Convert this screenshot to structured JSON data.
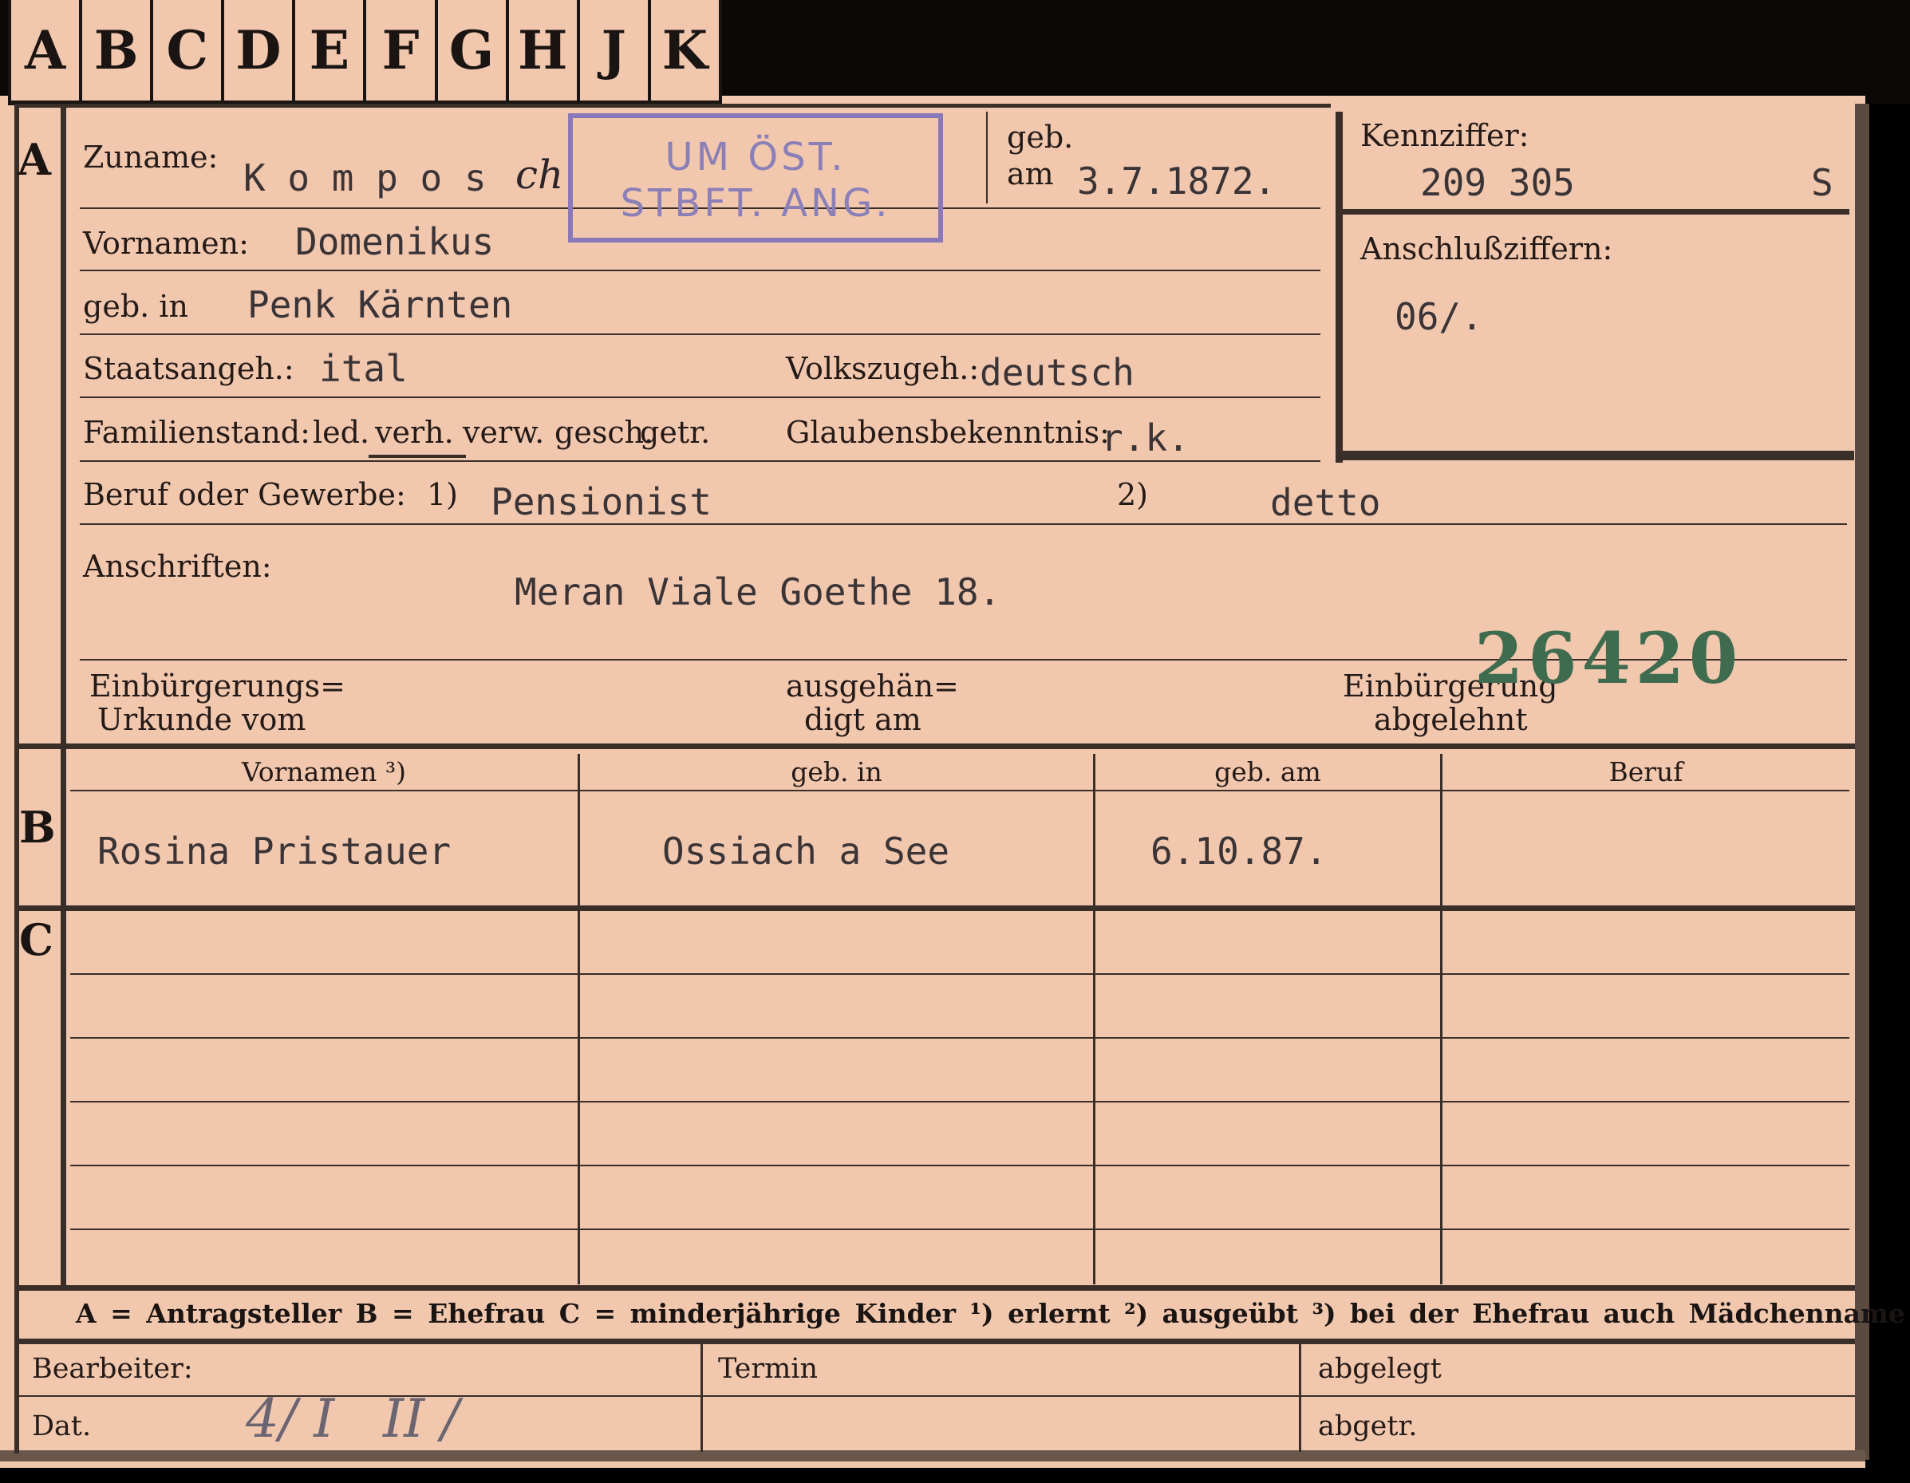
{
  "tabs": [
    "A",
    "B",
    "C",
    "D",
    "E",
    "F",
    "G",
    "H",
    "J",
    "K"
  ],
  "section_letters": {
    "a": "A",
    "b": "B",
    "c": "C"
  },
  "labels": {
    "zuname": "Zuname:",
    "geb": "geb.",
    "am": "am",
    "kennziffer": "Kennziffer:",
    "vornamen": "Vornamen:",
    "anschlussziffern": "Anschlußziffern:",
    "geb_in": "geb. in",
    "staatsangeh": "Staatsangeh.:",
    "volkszugeh": "Volkszugeh.:",
    "familienstand": "Familienstand:",
    "fam_led": "led.",
    "fam_verh": "verh.",
    "fam_verw": "verw.",
    "fam_gesch": "gesch.",
    "fam_getr": "getr.",
    "glaubensbekenntnis": "Glaubensbekenntnis:",
    "beruf": "Beruf oder Gewerbe:",
    "beruf_note1": "1)",
    "beruf_note2": "2)",
    "anschriften": "Anschriften:",
    "einbuergerung_1": "Einbürgerungs=",
    "einbuergerung_2": "Urkunde vom",
    "ausgehaendigt_1": "ausgehän=",
    "ausgehaendigt_2": "digt am",
    "abgelehnt_1": "Einbürgerung",
    "abgelehnt_2": "abgelehnt"
  },
  "applicant": {
    "zuname": "K o m p o s",
    "zuname_hand": "ch",
    "geb_am": "3.7.1872.",
    "kennziffer": "209 305",
    "kennziffer_suffix": "S",
    "vornamen": "Domenikus",
    "anschlussziffern": "06/.",
    "geb_in": "Penk Kärnten",
    "staatsangeh": "ital",
    "volkszugeh": "deutsch",
    "glaubensbekenntnis": "r.k.",
    "beruf_erlernt": "Pensionist",
    "beruf_ausgeuebt": "detto",
    "anschrift": "Meran Viale Goethe 18."
  },
  "stamp": {
    "line1": "UM ÖST.",
    "line2": "STBFT. ANG."
  },
  "number_stamp": "26420",
  "spouse_table": {
    "headers": [
      "Vornamen ³)",
      "geb. in",
      "geb. am",
      "Beruf"
    ],
    "row": [
      "Rosina Pristauer",
      "Ossiach a See",
      "6.10.87.",
      ""
    ]
  },
  "legend": "A = Antragsteller   B = Ehefrau   C = minderjährige Kinder   ¹) erlernt   ²) ausgeübt   ³) bei der Ehefrau auch Mädchenname",
  "footer": {
    "bearbeiter": "Bearbeiter:",
    "termin": "Termin",
    "abgelegt": "abgelegt",
    "dat": "Dat.",
    "abgetr": "abgetr.",
    "dat_hand_1": "4/ I",
    "dat_hand_2": "II /"
  }
}
